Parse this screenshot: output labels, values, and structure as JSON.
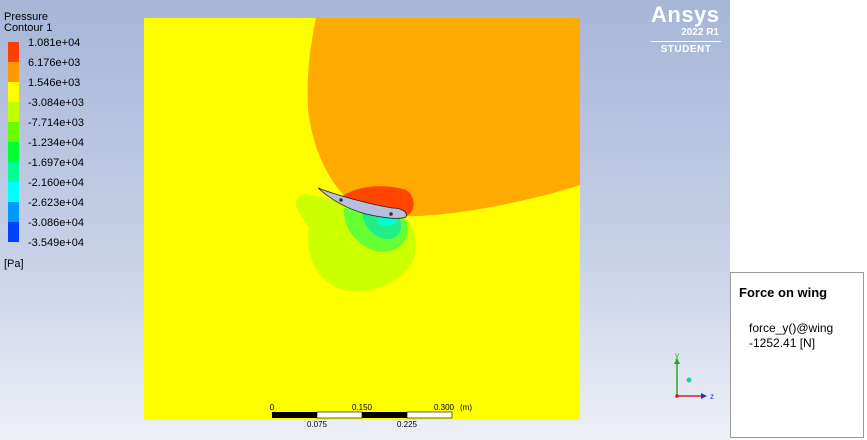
{
  "legend": {
    "title": "Pressure",
    "subtitle": "Contour 1",
    "units": "[Pa]",
    "levels": [
      {
        "label": "1.081e+04",
        "color": "#ff4000"
      },
      {
        "label": "6.176e+03",
        "color": "#ff9900"
      },
      {
        "label": "1.546e+03",
        "color": "#ffff00"
      },
      {
        "label": "-3.084e+03",
        "color": "#bfff00"
      },
      {
        "label": "-7.714e+03",
        "color": "#66ff00"
      },
      {
        "label": "-1.234e+04",
        "color": "#00ff33"
      },
      {
        "label": "-1.697e+04",
        "color": "#00ff99"
      },
      {
        "label": "-2.160e+04",
        "color": "#00ffff"
      },
      {
        "label": "-2.623e+04",
        "color": "#0099ff"
      },
      {
        "label": "-3.086e+04",
        "color": "#0040ff"
      },
      {
        "label": "-3.549e+04",
        "color": "#0000ff"
      }
    ]
  },
  "field_colors": {
    "yellow": "#ffff00",
    "orange": "#ffaa00",
    "red": "#ff4500",
    "yellow_green": "#ccff00",
    "green": "#66ff33",
    "teal": "#22ee88",
    "cyan": "#00ffcc",
    "wing": "#b7bfdc"
  },
  "scale_bar": {
    "top_labels": [
      "0",
      "0.150",
      "0.300"
    ],
    "unit": "(m)",
    "bottom_labels": [
      "0.075",
      "0.225"
    ]
  },
  "brand": {
    "name": "Ansys",
    "version": "2022 R1",
    "edition": "STUDENT"
  },
  "axes": {
    "y_label": "y",
    "z_label": "z"
  },
  "force_panel": {
    "title": "Force on wing",
    "expression": "force_y()@wing",
    "value": "-1252.41 [N]"
  }
}
